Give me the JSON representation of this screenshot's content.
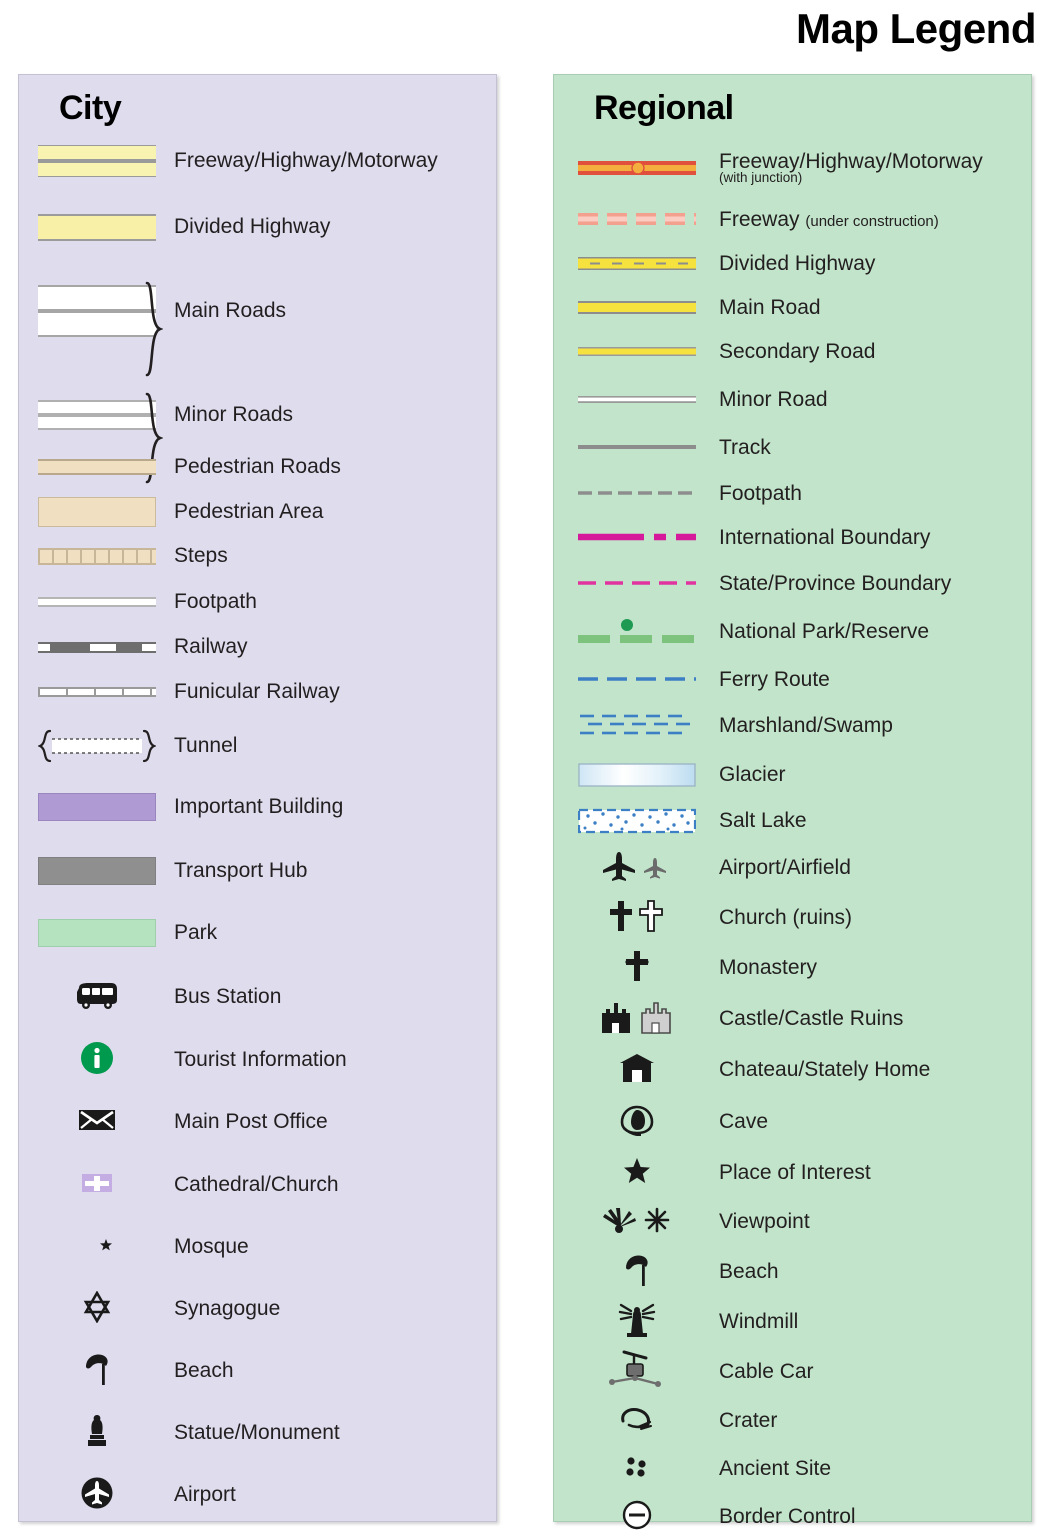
{
  "title": "Map Legend",
  "colors": {
    "city_panel_bg": "#dedced",
    "regional_panel_bg": "#c1e4ca",
    "highway_yellow": "#f8f3b0",
    "road_yellow": "#f5e23f",
    "freeway_red": "#e0503c",
    "freeway_orange": "#f4ae3d",
    "boundary_magenta": "#d6199a",
    "park_green": "#7dc37e",
    "ferry_blue": "#3c7fc4",
    "info_green": "#009a4e",
    "important_building_purple": "#b09ad4",
    "transport_hub_gray": "#8f8f8f",
    "park_swatch_green": "#b5e3c0",
    "pedestrian_tan": "#f0dfc0"
  },
  "city": {
    "heading": "City",
    "items": [
      {
        "icon": "freeway-swatch",
        "label": "Freeway/Highway/Motorway"
      },
      {
        "icon": "divided-highway-swatch",
        "label": "Divided Highway"
      },
      {
        "icon": "main-roads-swatch",
        "label": "Main Roads"
      },
      {
        "icon": "minor-roads-swatch",
        "label": "Minor Roads"
      },
      {
        "icon": "pedestrian-roads-swatch",
        "label": "Pedestrian Roads"
      },
      {
        "icon": "pedestrian-area-swatch",
        "label": "Pedestrian Area"
      },
      {
        "icon": "steps-swatch",
        "label": "Steps"
      },
      {
        "icon": "footpath-swatch",
        "label": "Footpath"
      },
      {
        "icon": "railway-swatch",
        "label": "Railway"
      },
      {
        "icon": "funicular-railway-swatch",
        "label": "Funicular Railway"
      },
      {
        "icon": "tunnel-swatch",
        "label": "Tunnel"
      },
      {
        "icon": "important-building-swatch",
        "label": "Important Building"
      },
      {
        "icon": "transport-hub-swatch",
        "label": "Transport Hub"
      },
      {
        "icon": "park-swatch",
        "label": "Park"
      },
      {
        "icon": "bus-icon",
        "label": "Bus Station"
      },
      {
        "icon": "tourist-information-icon",
        "label": "Tourist Information"
      },
      {
        "icon": "envelope-icon",
        "label": "Main Post Office"
      },
      {
        "icon": "church-cross-icon",
        "label": "Cathedral/Church"
      },
      {
        "icon": "crescent-star-icon",
        "label": "Mosque"
      },
      {
        "icon": "star-of-david-icon",
        "label": "Synagogue"
      },
      {
        "icon": "beach-umbrella-icon",
        "label": "Beach"
      },
      {
        "icon": "statue-icon",
        "label": "Statue/Monument"
      },
      {
        "icon": "airplane-circle-icon",
        "label": "Airport"
      }
    ]
  },
  "regional": {
    "heading": "Regional",
    "items": [
      {
        "icon": "freeway-junction-line",
        "label": "Freeway/Highway/Motorway",
        "sublabel_block": "(with junction)"
      },
      {
        "icon": "freeway-construction-line",
        "label": "Freeway ",
        "sublabel_inline": "(under construction)"
      },
      {
        "icon": "divided-highway-line",
        "label": "Divided Highway"
      },
      {
        "icon": "main-road-line",
        "label": "Main Road"
      },
      {
        "icon": "secondary-road-line",
        "label": "Secondary Road"
      },
      {
        "icon": "minor-road-line",
        "label": "Minor Road"
      },
      {
        "icon": "track-line",
        "label": "Track"
      },
      {
        "icon": "footpath-line",
        "label": "Footpath"
      },
      {
        "icon": "international-boundary-line",
        "label": "International Boundary"
      },
      {
        "icon": "state-boundary-line",
        "label": "State/Province Boundary"
      },
      {
        "icon": "national-park-line",
        "label": "National Park/Reserve"
      },
      {
        "icon": "ferry-route-line",
        "label": "Ferry Route"
      },
      {
        "icon": "marshland-swatch",
        "label": "Marshland/Swamp"
      },
      {
        "icon": "glacier-swatch",
        "label": "Glacier"
      },
      {
        "icon": "salt-lake-swatch",
        "label": "Salt Lake"
      },
      {
        "icon": "airport-airfield-icon",
        "label": "Airport/Airfield"
      },
      {
        "icon": "church-ruins-icon",
        "label": "Church (ruins)"
      },
      {
        "icon": "monastery-cross-icon",
        "label": "Monastery"
      },
      {
        "icon": "castle-icon",
        "label": "Castle/Castle Ruins"
      },
      {
        "icon": "chateau-icon",
        "label": "Chateau/Stately Home"
      },
      {
        "icon": "cave-icon",
        "label": "Cave"
      },
      {
        "icon": "star-icon",
        "label": "Place of Interest"
      },
      {
        "icon": "viewpoint-icon",
        "label": "Viewpoint"
      },
      {
        "icon": "beach-umbrella-icon",
        "label": "Beach"
      },
      {
        "icon": "windmill-icon",
        "label": "Windmill"
      },
      {
        "icon": "cable-car-icon",
        "label": "Cable Car"
      },
      {
        "icon": "crater-icon",
        "label": "Crater"
      },
      {
        "icon": "ancient-site-icon",
        "label": "Ancient Site"
      },
      {
        "icon": "border-control-icon",
        "label": "Border Control"
      }
    ]
  }
}
